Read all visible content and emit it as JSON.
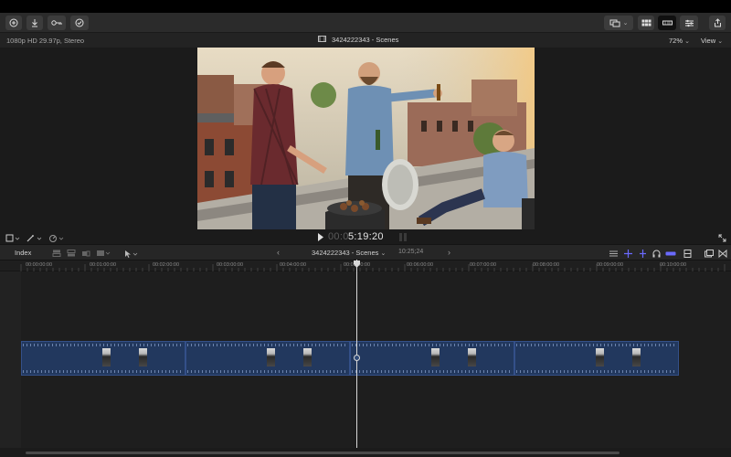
{
  "toolbar": {
    "left_buttons": [
      "import-icon",
      "download-icon",
      "keyword-icon",
      "checkmark-icon"
    ],
    "right_buttons": [
      "browser-toggle-icon",
      "viewer-layout-icon",
      "timeline-toggle-icon",
      "inspector-icon",
      "share-icon"
    ]
  },
  "viewer": {
    "format": "1080p HD 29.97p, Stereo",
    "title": "3424222343 - Scenes",
    "zoom": "72%",
    "view_label": "View",
    "timecode_dim": "00:0",
    "timecode": "5:19:20"
  },
  "timeline": {
    "index_label": "Index",
    "project_name": "3424222343 - Scenes",
    "duration": "10:25;24",
    "ruler_labels": [
      "00:00:00:00",
      "00:01:00:00",
      "00:02:00:00",
      "00:03:00:00",
      "00:04:00:00",
      "00:05:00:00",
      "00:06:00:00",
      "00:07:00:00",
      "00:08:00:00",
      "00:09:00:00",
      "00:10:00:00"
    ]
  },
  "colors": {
    "clip_fill": "#22385e",
    "clip_border": "#345089",
    "audio_accent": "#6a6aff"
  }
}
